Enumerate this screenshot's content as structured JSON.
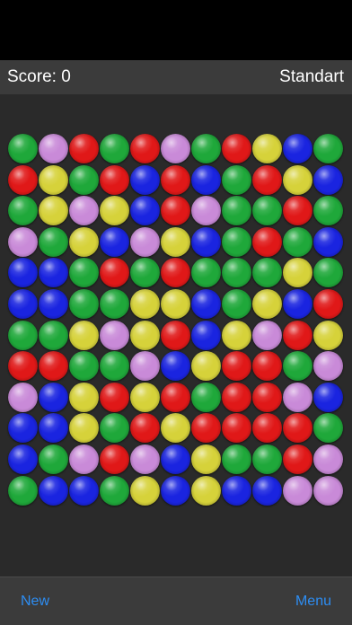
{
  "header": {
    "score_text": "Score: 0",
    "mode": "Standart"
  },
  "footer": {
    "new_label": "New",
    "menu_label": "Menu"
  },
  "colors": {
    "G": "#1fa83a",
    "P": "#c98ad8",
    "R": "#e01818",
    "B": "#1a24e0",
    "Y": "#d6d23a"
  },
  "board": [
    [
      "G",
      "P",
      "R",
      "G",
      "R",
      "P",
      "G",
      "R",
      "Y",
      "B",
      "G"
    ],
    [
      "R",
      "Y",
      "G",
      "R",
      "B",
      "R",
      "B",
      "G",
      "R",
      "Y",
      "B"
    ],
    [
      "G",
      "Y",
      "P",
      "Y",
      "B",
      "R",
      "P",
      "G",
      "G",
      "R",
      "G"
    ],
    [
      "P",
      "G",
      "Y",
      "B",
      "P",
      "Y",
      "B",
      "G",
      "R",
      "G",
      "B"
    ],
    [
      "B",
      "B",
      "G",
      "R",
      "G",
      "R",
      "G",
      "G",
      "G",
      "Y",
      "G"
    ],
    [
      "B",
      "B",
      "G",
      "G",
      "Y",
      "Y",
      "B",
      "G",
      "Y",
      "B",
      "R"
    ],
    [
      "G",
      "G",
      "Y",
      "P",
      "Y",
      "R",
      "B",
      "Y",
      "P",
      "R",
      "Y"
    ],
    [
      "R",
      "R",
      "G",
      "G",
      "P",
      "B",
      "Y",
      "R",
      "R",
      "G",
      "P"
    ],
    [
      "P",
      "B",
      "Y",
      "R",
      "Y",
      "R",
      "G",
      "R",
      "R",
      "P",
      "B"
    ],
    [
      "B",
      "B",
      "Y",
      "G",
      "R",
      "Y",
      "R",
      "R",
      "R",
      "R",
      "G"
    ],
    [
      "B",
      "G",
      "P",
      "R",
      "P",
      "B",
      "Y",
      "G",
      "G",
      "R",
      "P"
    ],
    [
      "G",
      "B",
      "B",
      "G",
      "Y",
      "B",
      "Y",
      "B",
      "B",
      "P",
      "P"
    ]
  ]
}
